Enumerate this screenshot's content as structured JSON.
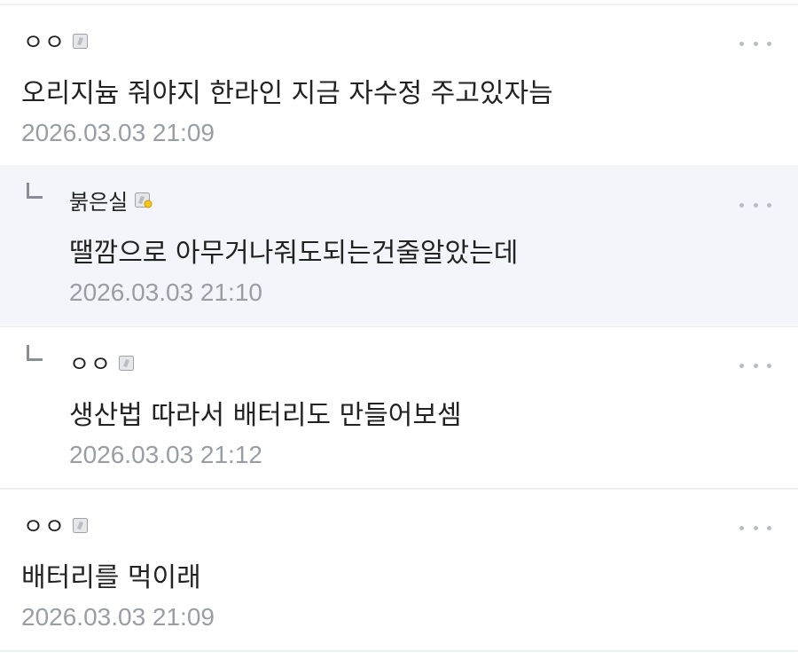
{
  "comments": [
    {
      "author": "ㅇㅇ",
      "badge_icon": "gray-user-badge-icon",
      "text": "오리지늄 줘야지 한라인 지금 자수정 주고있자늠",
      "date": "2026.03.03 21:09",
      "is_reply": false
    },
    {
      "author": "붉은실",
      "badge_icon": "gray-user-badge-with-yellow-dot-icon",
      "text": "땔깜으로 아무거나줘도되는건줄알았는데",
      "date": "2026.03.03 21:10",
      "is_reply": true
    },
    {
      "author": "ㅇㅇ",
      "badge_icon": "gray-user-badge-icon",
      "text": "생산법 따라서 배터리도 만들어보셈",
      "date": "2026.03.03 21:12",
      "is_reply": true
    },
    {
      "author": "ㅇㅇ",
      "badge_icon": "gray-user-badge-icon",
      "text": "배터리를 먹이래",
      "date": "2026.03.03 21:09",
      "is_reply": false
    }
  ],
  "colors": {
    "highlight_background": "#f3f5fa",
    "text": "#222222",
    "date": "#9a9da3",
    "more_dots": "#b8bcc4"
  }
}
